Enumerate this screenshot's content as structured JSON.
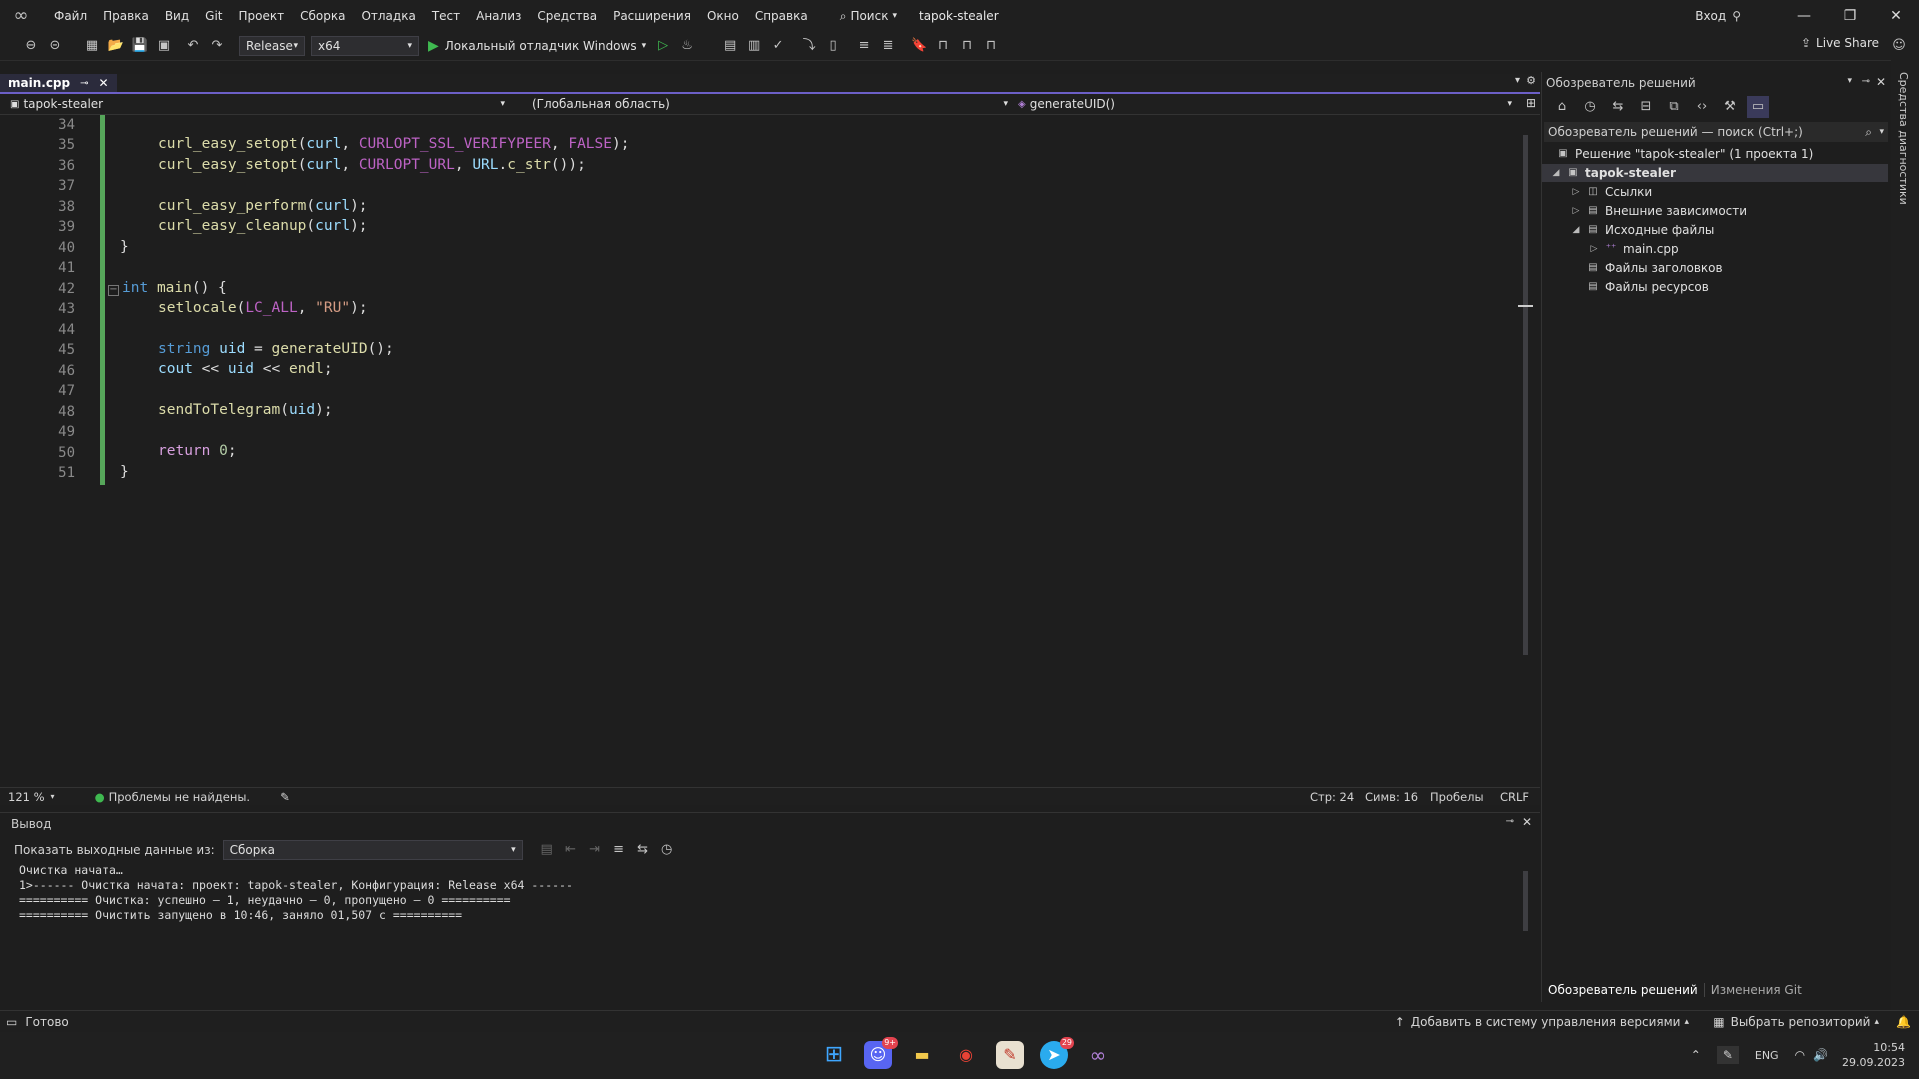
{
  "titlebar": {
    "menu": [
      "Файл",
      "Правка",
      "Вид",
      "Git",
      "Проект",
      "Сборка",
      "Отладка",
      "Тест",
      "Анализ",
      "Средства",
      "Расширения",
      "Окно",
      "Справка"
    ],
    "search_label": "Поиск",
    "project_name": "tapok-stealer",
    "login": "Вход"
  },
  "toolbar": {
    "configuration": "Release",
    "platform": "x64",
    "debugger": "Локальный отладчик Windows",
    "live_share": "Live Share"
  },
  "editor": {
    "tab": "main.cpp",
    "nav_project": "tapok-stealer",
    "nav_scope": "(Глобальная область)",
    "nav_member": "generateUID()",
    "line_numbers": [
      "34",
      "35",
      "36",
      "37",
      "38",
      "39",
      "40",
      "41",
      "42",
      "43",
      "44",
      "45",
      "46",
      "47",
      "48",
      "49",
      "50",
      "51"
    ],
    "zoom": "121 %",
    "issues": "Проблемы не найдены.",
    "line": "Стр: 24",
    "col": "Симв: 16",
    "whitespace": "Пробелы",
    "eol": "CRLF"
  },
  "output": {
    "title": "Вывод",
    "show_from_label": "Показать выходные данные из:",
    "source": "Сборка",
    "lines": [
      "Очистка начата…",
      "1>------ Очистка начата: проект: tapok-stealer, Конфигурация: Release x64 ------",
      "========== Очистка: успешно — 1, неудачно — 0, пропущено — 0 ==========",
      "========== Очистить запущено в 10:46, заняло 01,507 с =========="
    ]
  },
  "solution": {
    "title": "Обозреватель решений",
    "search_placeholder": "Обозреватель решений — поиск (Ctrl+;)",
    "solution_node": "Решение \"tapok-stealer\" (1 проекта 1)",
    "project_node": "tapok-stealer",
    "refs": "Ссылки",
    "external": "Внешние зависимости",
    "sources": "Исходные файлы",
    "main_cpp": "main.cpp",
    "headers": "Файлы заголовков",
    "resources": "Файлы ресурсов",
    "tab_se": "Обозреватель решений",
    "tab_git": "Изменения Git",
    "diag": "Средства диагностики"
  },
  "statusbar": {
    "ready": "Готово",
    "add_vcs": "Добавить в систему управления версиями",
    "choose_repo": "Выбрать репозиторий"
  },
  "taskbar": {
    "lang": "ENG",
    "time": "10:54",
    "date": "29.09.2023",
    "discord_badge": "9+",
    "telegram_badge": "29"
  },
  "colors": {
    "accent": "#6c5fc7",
    "change_bar": "#56a65a",
    "run_green": "#3fb950"
  }
}
